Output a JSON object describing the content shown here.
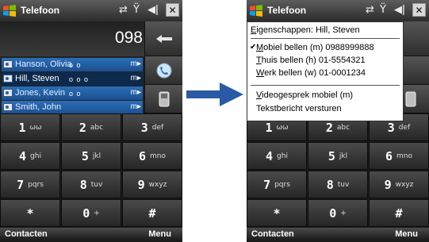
{
  "left_phone": {
    "title": "Telefoon",
    "number": "098",
    "contacts": [
      {
        "name": "Hanson, Olivia",
        "tag": "m▸"
      },
      {
        "name": "Hill, Steven",
        "tag": "m▸"
      },
      {
        "name": "Jones, Kevin",
        "tag": "m▸"
      },
      {
        "name": "Smith, John",
        "tag": "m▸"
      }
    ],
    "soft_left": "Contacten",
    "soft_right": "Menu"
  },
  "right_phone": {
    "title": "Telefoon",
    "menu_header_prefix": "E",
    "menu_header_rest": "igenschappen: Hill, Steven",
    "menu": [
      {
        "underline": "M",
        "rest": "obiel bellen (m) 0988999888",
        "checked": true
      },
      {
        "underline": "T",
        "rest": "huis bellen (h) 01-5554321",
        "checked": false
      },
      {
        "underline": "W",
        "rest": "erk bellen (w) 01-0001234",
        "checked": false
      },
      {
        "underline": "V",
        "rest": "ideogesprek mobiel (m)",
        "checked": false
      },
      {
        "underline": "",
        "rest": "Tekstbericht versturen",
        "checked": false
      }
    ],
    "soft_left": "Contacten",
    "soft_right": "Menu"
  },
  "keypad": [
    {
      "digit": "1",
      "letters": "ωω"
    },
    {
      "digit": "2",
      "letters": "abc"
    },
    {
      "digit": "3",
      "letters": "def"
    },
    {
      "digit": "4",
      "letters": "ghi"
    },
    {
      "digit": "5",
      "letters": "jkl"
    },
    {
      "digit": "6",
      "letters": "mno"
    },
    {
      "digit": "7",
      "letters": "pqrs"
    },
    {
      "digit": "8",
      "letters": "tuv"
    },
    {
      "digit": "9",
      "letters": "wxyz"
    },
    {
      "digit": "*",
      "letters": ""
    },
    {
      "digit": "0",
      "letters": "+"
    },
    {
      "digit": "#",
      "letters": ""
    }
  ],
  "status_icons": [
    "sync-icon",
    "signal-icon",
    "volume-icon"
  ],
  "colors": {
    "arrow": "#2a5aa6",
    "contact_bg": "#2a6fb8",
    "selected_contact": "#0d2a4c"
  }
}
